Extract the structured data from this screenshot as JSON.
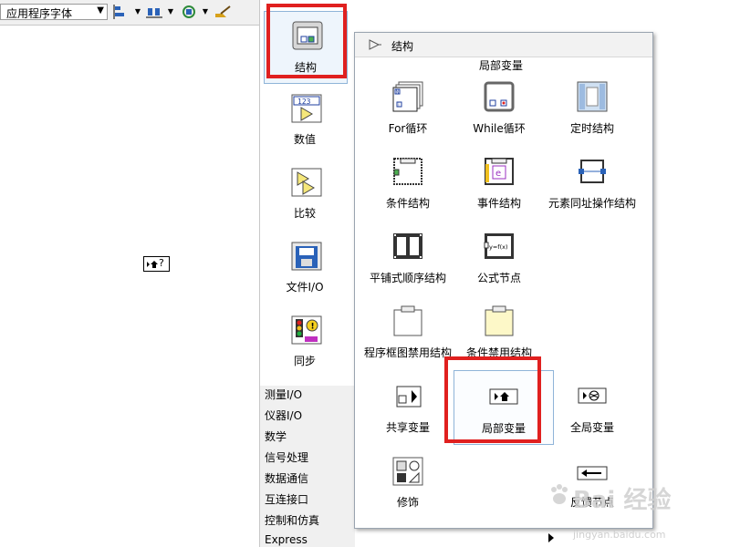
{
  "toolbar": {
    "font_select_value": "应用程序字体",
    "buttons": [
      "align-objects",
      "distribute-objects",
      "reorder",
      "cleanup"
    ]
  },
  "block_diagram": {
    "node_label": "?"
  },
  "palette": {
    "icon_items": [
      {
        "label": "结构"
      },
      {
        "label": "数值"
      },
      {
        "label": "比较"
      },
      {
        "label": "文件I/O"
      },
      {
        "label": "同步"
      }
    ],
    "categories": [
      "测量I/O",
      "仪器I/O",
      "数学",
      "信号处理",
      "数据通信",
      "互连接口",
      "控制和仿真",
      "Express"
    ]
  },
  "subpalette": {
    "title": "结构",
    "tooltip": "局部变量",
    "items": [
      {
        "label": "For循环"
      },
      {
        "label": "While循环"
      },
      {
        "label": "定时结构"
      },
      {
        "label": "条件结构"
      },
      {
        "label": "事件结构"
      },
      {
        "label": "元素同址操作结构"
      },
      {
        "label": "平铺式顺序结构"
      },
      {
        "label": "公式节点"
      },
      {
        "label": "程序框图禁用结构"
      },
      {
        "label": "条件禁用结构"
      },
      {
        "label": "共享变量"
      },
      {
        "label": "局部变量"
      },
      {
        "label": "全局变量"
      },
      {
        "label": "修饰"
      },
      {
        "label": "反馈节点"
      }
    ]
  },
  "watermark": {
    "brand": "Bai 经验",
    "url": "jingyan.baidu.com"
  },
  "colors": {
    "highlight": "#e0201f",
    "selected_border": "#8fb4d8",
    "panel_gray": "#f0f0f0"
  }
}
